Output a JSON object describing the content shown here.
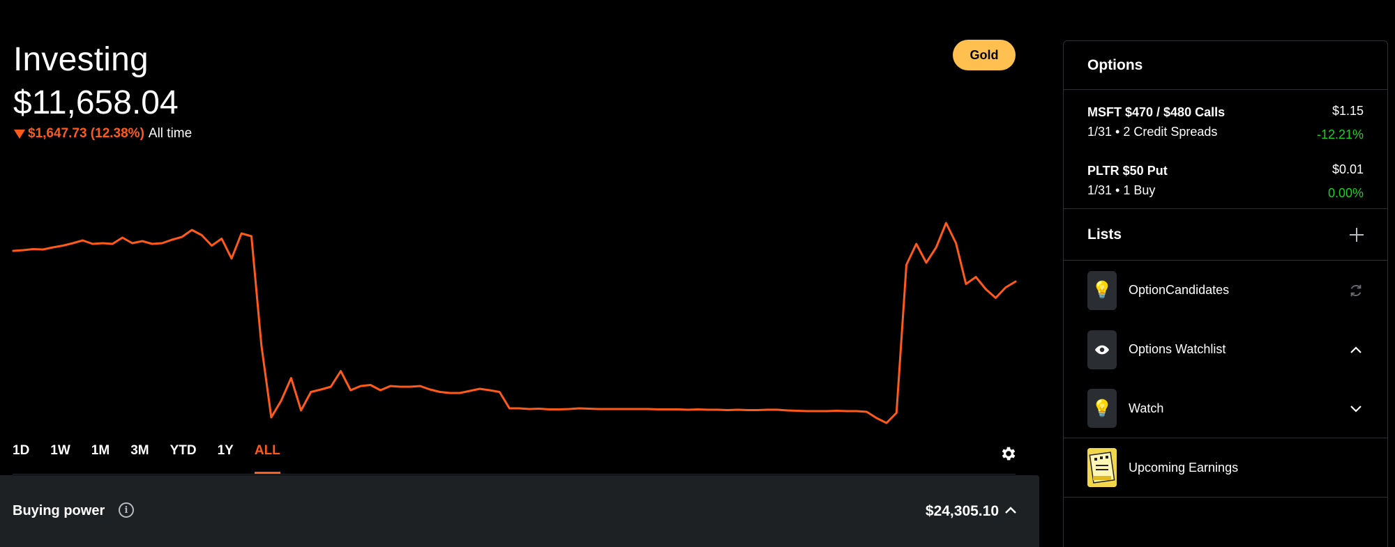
{
  "header": {
    "title": "Investing",
    "portfolio_value": "$11,658.04",
    "change_amount": "$1,647.73 (12.38%)",
    "change_period": "All time",
    "badge_label": "Gold"
  },
  "colors": {
    "accent": "#ff5a1a",
    "gold": "#ffc04f",
    "positive": "#16d21f",
    "panel": "#1e2124"
  },
  "chart_data": {
    "type": "line",
    "series_color": "#ff5a1a",
    "values": [
      12690,
      12692,
      12695,
      12694,
      12700,
      12705,
      12712,
      12720,
      12710,
      12712,
      12710,
      12728,
      12712,
      12718,
      12710,
      12712,
      12722,
      12730,
      12750,
      12735,
      12705,
      12725,
      12668,
      12740,
      12732,
      12420,
      12212,
      12260,
      12325,
      12232,
      12285,
      12292,
      12300,
      12345,
      12290,
      12302,
      12305,
      12290,
      12302,
      12300,
      12300,
      12302,
      12292,
      12285,
      12282,
      12282,
      12288,
      12294,
      12290,
      12285,
      12238,
      12238,
      12236,
      12237,
      12235,
      12235,
      12236,
      12238,
      12237,
      12236,
      12236,
      12236,
      12236,
      12236,
      12236,
      12235,
      12235,
      12235,
      12234,
      12235,
      12234,
      12234,
      12233,
      12234,
      12233,
      12233,
      12234,
      12234,
      12232,
      12231,
      12230,
      12230,
      12230,
      12231,
      12230,
      12230,
      12228,
      12210,
      12196,
      12225,
      12650,
      12710,
      12656,
      12700,
      12770,
      12712,
      12595,
      12615,
      12580,
      12555,
      12585,
      12602
    ]
  },
  "range_tabs": [
    {
      "label": "1D"
    },
    {
      "label": "1W"
    },
    {
      "label": "1M"
    },
    {
      "label": "3M"
    },
    {
      "label": "YTD"
    },
    {
      "label": "1Y"
    },
    {
      "label": "ALL",
      "active": true
    }
  ],
  "buying_power": {
    "label": "Buying power",
    "info_icon": "info-icon",
    "value": "$24,305.10"
  },
  "sidebar": {
    "options_title": "Options",
    "options": [
      {
        "name": "MSFT $470 / $480 Calls",
        "detail": "1/31 • 2 Credit Spreads",
        "price": "$1.15",
        "change": "-12.21%"
      },
      {
        "name": "PLTR $50 Put",
        "detail": "1/31 • 1 Buy",
        "price": "$0.01",
        "change": "0.00%"
      }
    ],
    "lists_title": "Lists",
    "lists": [
      {
        "icon": "lightbulb-icon",
        "glyph": "💡",
        "label": "OptionCandidates",
        "action": "refresh-icon"
      },
      {
        "icon": "eye-icon",
        "glyph": "",
        "label": "Options Watchlist",
        "action": "chevron-up-icon"
      },
      {
        "icon": "lightbulb-icon",
        "glyph": "💡",
        "label": "Watch",
        "action": "chevron-down-icon"
      }
    ],
    "earnings_label": "Upcoming Earnings"
  }
}
